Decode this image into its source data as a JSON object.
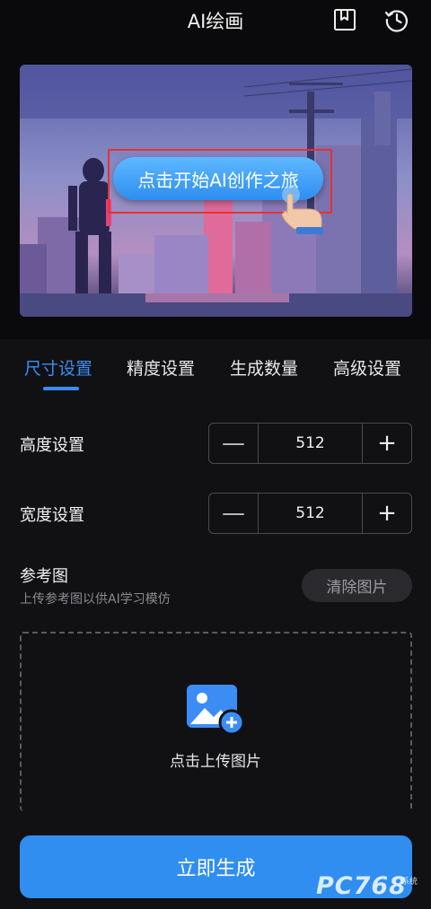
{
  "header": {
    "title": "AI绘画",
    "icons": [
      "bookmark-icon",
      "history-icon"
    ]
  },
  "banner": {
    "start_label": "点击开始AI创作之旅"
  },
  "tabs": [
    {
      "label": "尺寸设置",
      "active": true
    },
    {
      "label": "精度设置",
      "active": false
    },
    {
      "label": "生成数量",
      "active": false
    },
    {
      "label": "高级设置",
      "active": false
    }
  ],
  "height_setting": {
    "label": "高度设置",
    "value": "512"
  },
  "width_setting": {
    "label": "宽度设置",
    "value": "512"
  },
  "stepper_symbols": {
    "minus": "—",
    "plus": "+"
  },
  "reference": {
    "title": "参考图",
    "subtitle": "上传参考图以供AI学习模仿",
    "clear_label": "清除图片",
    "upload_label": "点击上传图片"
  },
  "generate_label": "立即生成",
  "watermark": {
    "brand": "PC768",
    "small": "系统"
  },
  "colors": {
    "accent": "#3b8df5",
    "background": "#0a0a0c",
    "highlight": "#e8322d"
  }
}
